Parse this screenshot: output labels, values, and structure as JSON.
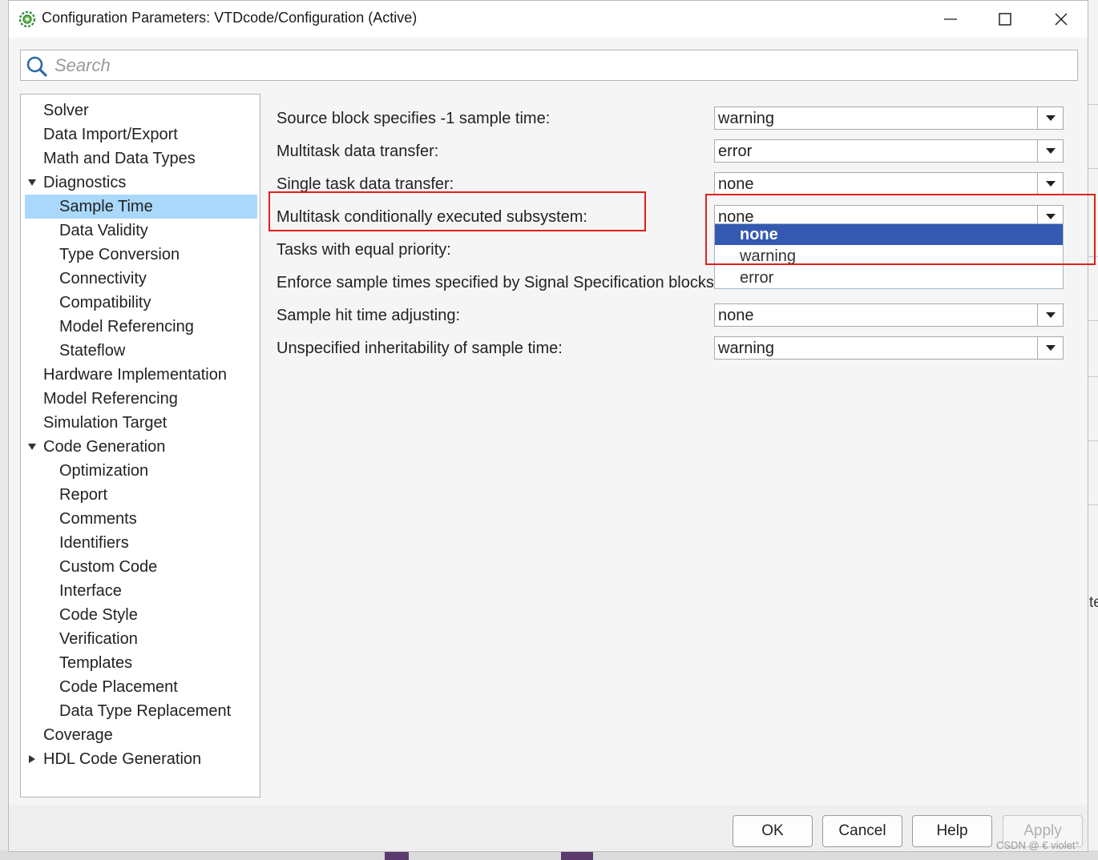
{
  "window": {
    "title": "Configuration Parameters: VTDcode/Configuration (Active)"
  },
  "search": {
    "placeholder": "Search"
  },
  "tree": [
    {
      "label": "Solver",
      "level": 0,
      "expander": "none",
      "selected": false
    },
    {
      "label": "Data Import/Export",
      "level": 0,
      "expander": "none",
      "selected": false
    },
    {
      "label": "Math and Data Types",
      "level": 0,
      "expander": "none",
      "selected": false
    },
    {
      "label": "Diagnostics",
      "level": 0,
      "expander": "expanded",
      "selected": false
    },
    {
      "label": "Sample Time",
      "level": 1,
      "expander": "none",
      "selected": true
    },
    {
      "label": "Data Validity",
      "level": 1,
      "expander": "none",
      "selected": false
    },
    {
      "label": "Type Conversion",
      "level": 1,
      "expander": "none",
      "selected": false
    },
    {
      "label": "Connectivity",
      "level": 1,
      "expander": "none",
      "selected": false
    },
    {
      "label": "Compatibility",
      "level": 1,
      "expander": "none",
      "selected": false
    },
    {
      "label": "Model Referencing",
      "level": 1,
      "expander": "none",
      "selected": false
    },
    {
      "label": "Stateflow",
      "level": 1,
      "expander": "none",
      "selected": false
    },
    {
      "label": "Hardware Implementation",
      "level": 0,
      "expander": "none",
      "selected": false
    },
    {
      "label": "Model Referencing",
      "level": 0,
      "expander": "none",
      "selected": false
    },
    {
      "label": "Simulation Target",
      "level": 0,
      "expander": "none",
      "selected": false
    },
    {
      "label": "Code Generation",
      "level": 0,
      "expander": "expanded",
      "selected": false
    },
    {
      "label": "Optimization",
      "level": 1,
      "expander": "none",
      "selected": false
    },
    {
      "label": "Report",
      "level": 1,
      "expander": "none",
      "selected": false
    },
    {
      "label": "Comments",
      "level": 1,
      "expander": "none",
      "selected": false
    },
    {
      "label": "Identifiers",
      "level": 1,
      "expander": "none",
      "selected": false
    },
    {
      "label": "Custom Code",
      "level": 1,
      "expander": "none",
      "selected": false
    },
    {
      "label": "Interface",
      "level": 1,
      "expander": "none",
      "selected": false
    },
    {
      "label": "Code Style",
      "level": 1,
      "expander": "none",
      "selected": false
    },
    {
      "label": "Verification",
      "level": 1,
      "expander": "none",
      "selected": false
    },
    {
      "label": "Templates",
      "level": 1,
      "expander": "none",
      "selected": false
    },
    {
      "label": "Code Placement",
      "level": 1,
      "expander": "none",
      "selected": false
    },
    {
      "label": "Data Type Replacement",
      "level": 1,
      "expander": "none",
      "selected": false
    },
    {
      "label": "Coverage",
      "level": 0,
      "expander": "none",
      "selected": false
    },
    {
      "label": "HDL Code Generation",
      "level": 0,
      "expander": "collapsed",
      "selected": false
    }
  ],
  "params": [
    {
      "label": "Source block specifies -1 sample time:",
      "value": "warning",
      "control": "select"
    },
    {
      "label": "Multitask data transfer:",
      "value": "error",
      "control": "select"
    },
    {
      "label": "Single task data transfer:",
      "value": "none",
      "control": "select"
    },
    {
      "label": "Multitask conditionally executed subsystem:",
      "value": "none",
      "control": "select-open"
    },
    {
      "label": "Tasks with equal priority:",
      "value": "",
      "control": "hidden"
    },
    {
      "label": "Enforce sample times specified by Signal Specification blocks:",
      "value": "",
      "control": "hidden"
    },
    {
      "label": "Sample hit time adjusting:",
      "value": "none",
      "control": "select"
    },
    {
      "label": "Unspecified inheritability of sample time:",
      "value": "warning",
      "control": "select"
    }
  ],
  "dropdown": {
    "options": [
      "none",
      "warning",
      "error"
    ],
    "highlighted_index": 0
  },
  "buttons": {
    "ok": "OK",
    "cancel": "Cancel",
    "help": "Help",
    "apply": "Apply"
  },
  "watermark": "CSDN @ € violet°",
  "background_fragment": "te",
  "colors": {
    "selection": "#a9d8fb",
    "dropdown_highlight": "#3559b0",
    "annotation": "#e0201b"
  }
}
